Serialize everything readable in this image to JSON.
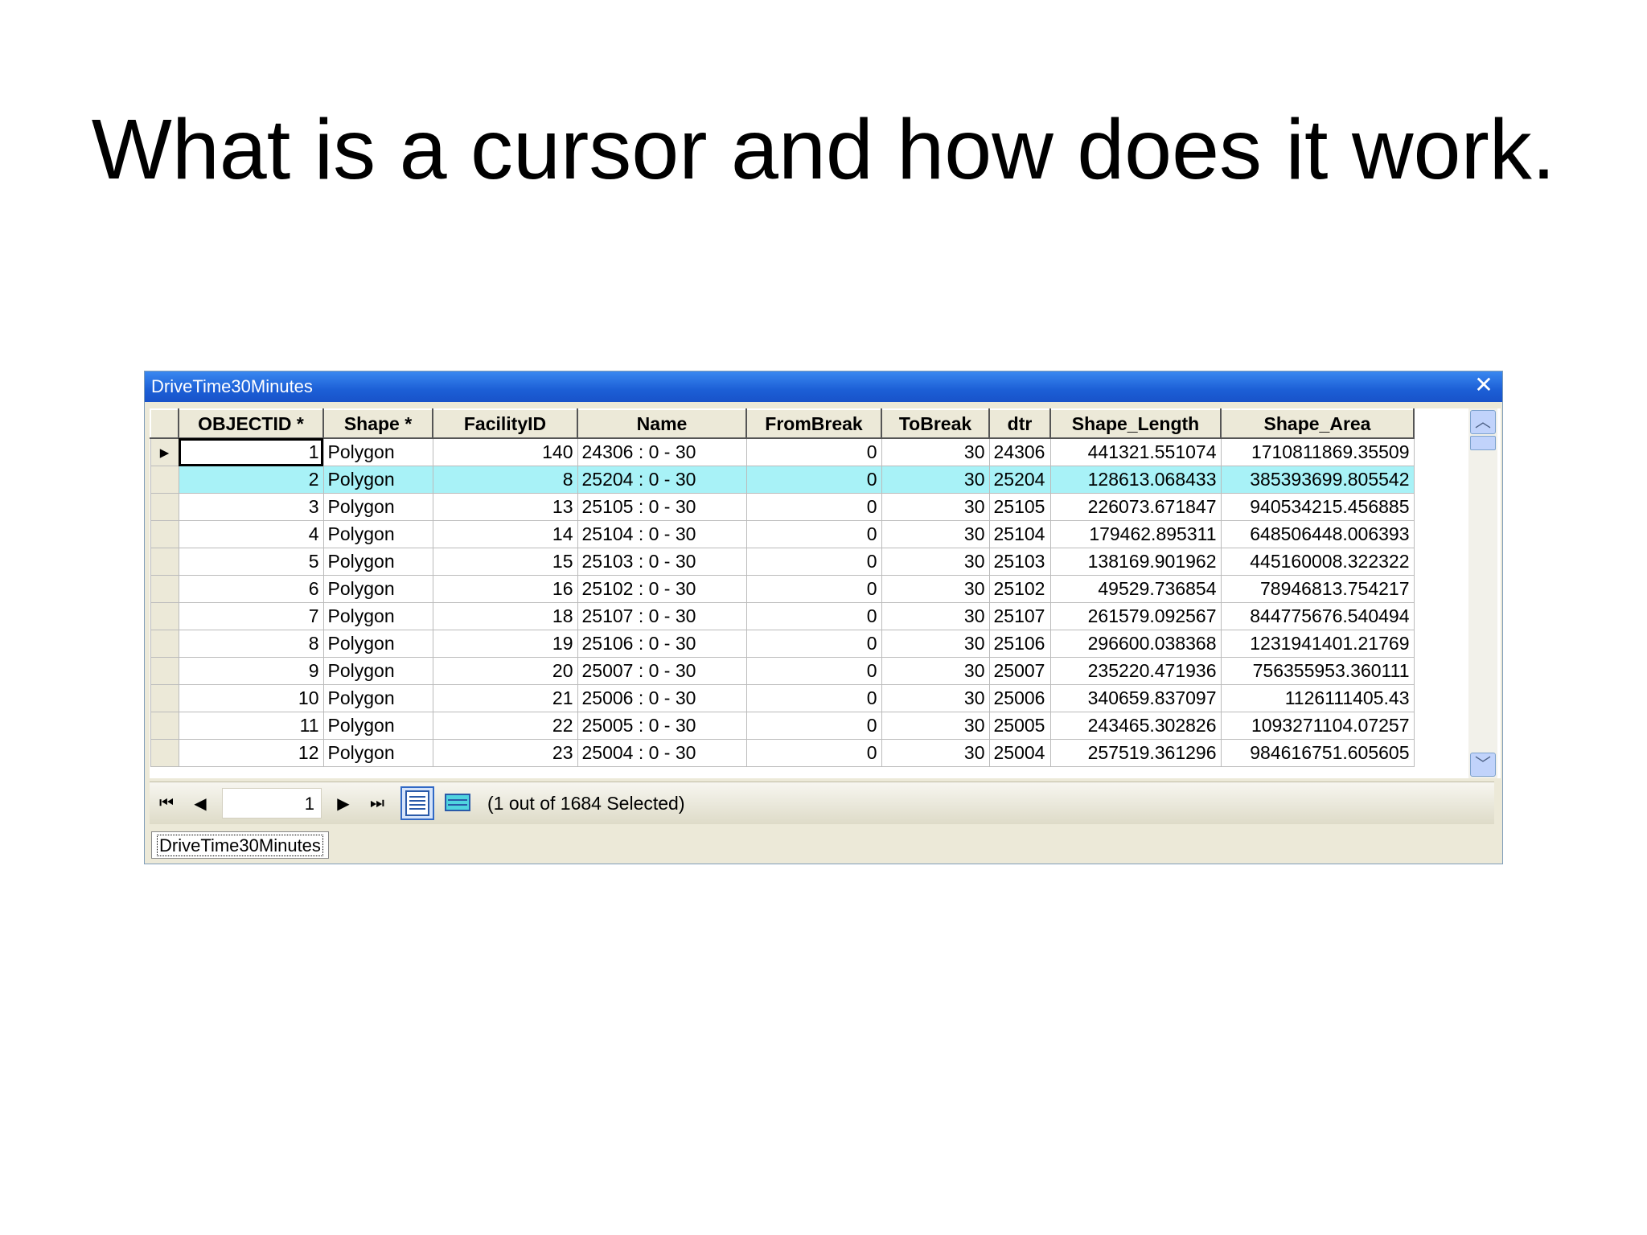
{
  "slide": {
    "title": "What is a cursor and how does it work."
  },
  "window": {
    "title": "DriveTime30Minutes",
    "close_glyph": "✕"
  },
  "table": {
    "columns": [
      "OBJECTID *",
      "Shape *",
      "FacilityID",
      "Name",
      "FromBreak",
      "ToBreak",
      "dtr",
      "Shape_Length",
      "Shape_Area"
    ],
    "rows": [
      [
        "1",
        "Polygon",
        "140",
        "24306 : 0 - 30",
        "0",
        "30",
        "24306",
        "441321.551074",
        "1710811869.35509"
      ],
      [
        "2",
        "Polygon",
        "8",
        "25204 : 0 - 30",
        "0",
        "30",
        "25204",
        "128613.068433",
        "385393699.805542"
      ],
      [
        "3",
        "Polygon",
        "13",
        "25105 : 0 - 30",
        "0",
        "30",
        "25105",
        "226073.671847",
        "940534215.456885"
      ],
      [
        "4",
        "Polygon",
        "14",
        "25104 : 0 - 30",
        "0",
        "30",
        "25104",
        "179462.895311",
        "648506448.006393"
      ],
      [
        "5",
        "Polygon",
        "15",
        "25103 : 0 - 30",
        "0",
        "30",
        "25103",
        "138169.901962",
        "445160008.322322"
      ],
      [
        "6",
        "Polygon",
        "16",
        "25102 : 0 - 30",
        "0",
        "30",
        "25102",
        "49529.736854",
        "78946813.754217"
      ],
      [
        "7",
        "Polygon",
        "18",
        "25107 : 0 - 30",
        "0",
        "30",
        "25107",
        "261579.092567",
        "844775676.540494"
      ],
      [
        "8",
        "Polygon",
        "19",
        "25106 : 0 - 30",
        "0",
        "30",
        "25106",
        "296600.038368",
        "1231941401.21769"
      ],
      [
        "9",
        "Polygon",
        "20",
        "25007 : 0 - 30",
        "0",
        "30",
        "25007",
        "235220.471936",
        "756355953.360111"
      ],
      [
        "10",
        "Polygon",
        "21",
        "25006 : 0 - 30",
        "0",
        "30",
        "25006",
        "340659.837097",
        "1126111405.43"
      ],
      [
        "11",
        "Polygon",
        "22",
        "25005 : 0 - 30",
        "0",
        "30",
        "25005",
        "243465.302826",
        "1093271104.07257"
      ],
      [
        "12",
        "Polygon",
        "23",
        "25004 : 0 - 30",
        "0",
        "30",
        "25004",
        "257519.361296",
        "984616751.605605"
      ]
    ],
    "current_row_marker": "▸",
    "highlight_color": "#a8f2f7"
  },
  "navbar": {
    "first_icon": "⏮",
    "prev_icon": "◀",
    "next_icon": "▶",
    "last_icon": "⏭",
    "record_number": "1",
    "status": "(1 out of 1684 Selected)"
  },
  "tabs": [
    {
      "label": "DriveTime30Minutes"
    }
  ],
  "scrollbar": {
    "up_icon": "︿",
    "down_icon": "﹀"
  }
}
